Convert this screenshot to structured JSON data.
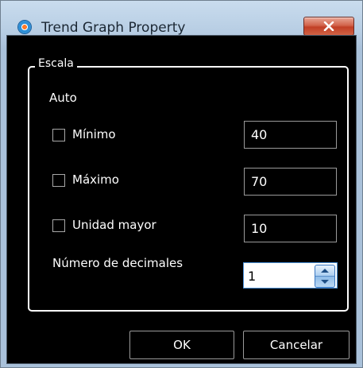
{
  "window": {
    "title": "Trend Graph Property",
    "close_icon": "close-x-icon",
    "app_icon": "trend-graph-app-icon"
  },
  "group": {
    "legend": "Escala",
    "auto_label": "Auto"
  },
  "fields": {
    "minimo": {
      "label": "Mínimo",
      "checked": false,
      "value": "40"
    },
    "maximo": {
      "label": "Máximo",
      "checked": false,
      "value": "70"
    },
    "unidad": {
      "label": "Unidad mayor",
      "checked": false,
      "value": "10"
    }
  },
  "decimals": {
    "label": "Número de decimales",
    "value": "1"
  },
  "buttons": {
    "ok": "OK",
    "cancel": "Cancelar"
  },
  "colors": {
    "content_bg": "#000000",
    "text": "#ffffff",
    "titlebar": "#b7cde3",
    "close_button": "#c13f26",
    "spinner_border": "#4a90d9"
  }
}
